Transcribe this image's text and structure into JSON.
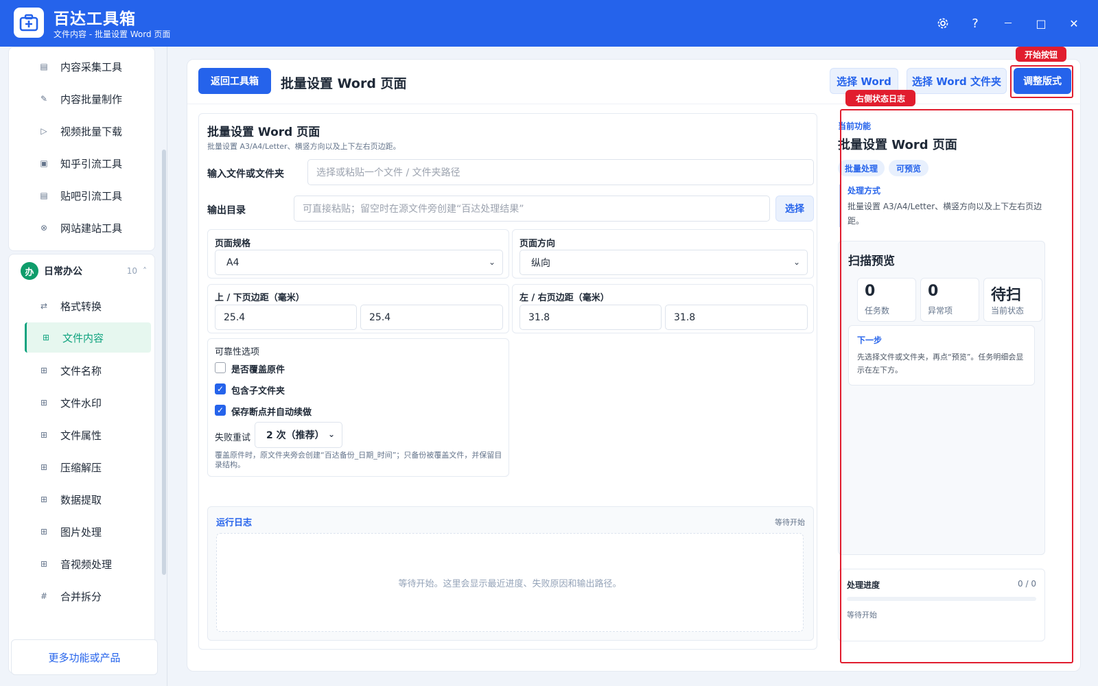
{
  "app": {
    "title": "百达工具箱",
    "subtitle": "文件内容 - 批量设置 Word 页面"
  },
  "window_controls": {
    "settings_icon": "gear-icon",
    "help": "?",
    "minimize": "－",
    "maximize": "□",
    "close": "✕"
  },
  "sidebar": {
    "top_items": [
      {
        "label": "内容采集工具",
        "icon": "collect-icon"
      },
      {
        "label": "内容批量制作",
        "icon": "pen-icon"
      },
      {
        "label": "视频批量下载",
        "icon": "video-icon"
      },
      {
        "label": "知乎引流工具",
        "icon": "zhihu-icon"
      },
      {
        "label": "贴吧引流工具",
        "icon": "tieba-icon"
      },
      {
        "label": "网站建站工具",
        "icon": "web-icon"
      }
    ],
    "group": {
      "badge": "办",
      "title": "日常办公",
      "count": "10",
      "chevron": "˄"
    },
    "group_items": [
      {
        "label": "格式转换",
        "icon": "swap-icon"
      },
      {
        "label": "文件内容",
        "icon": "grid-icon"
      },
      {
        "label": "文件名称",
        "icon": "grid-icon"
      },
      {
        "label": "文件水印",
        "icon": "grid-icon"
      },
      {
        "label": "文件属性",
        "icon": "grid-icon"
      },
      {
        "label": "压缩解压",
        "icon": "grid-icon"
      },
      {
        "label": "数据提取",
        "icon": "grid-icon"
      },
      {
        "label": "图片处理",
        "icon": "grid-icon"
      },
      {
        "label": "音视频处理",
        "icon": "grid-icon"
      },
      {
        "label": "合并拆分",
        "icon": "hash-icon"
      }
    ],
    "active_item": "文件内容",
    "more_button": "更多功能或产品"
  },
  "header": {
    "back_button": "返回工具箱",
    "page_title": "批量设置 Word 页面",
    "select_word": "选择 Word",
    "select_word_folder": "选择 Word 文件夹",
    "run_button": "调整版式"
  },
  "annotations": {
    "start_button_tag": "开始按钮",
    "right_log_tag": "右侧状态日志"
  },
  "form": {
    "title": "批量设置 Word 页面",
    "description": "批量设置 A3/A4/Letter、横竖方向以及上下左右页边距。",
    "input_label": "输入文件或文件夹",
    "input_placeholder": "选择或粘贴一个文件 / 文件夹路径",
    "output_label": "输出目录",
    "output_placeholder": "可直接粘贴；留空时在源文件旁创建“百达处理结果”",
    "output_select": "选择",
    "page_size_label": "页面规格",
    "page_size_value": "A4",
    "orientation_label": "页面方向",
    "orientation_value": "纵向",
    "tb_margin_label": "上 / 下页边距（毫米）",
    "top_margin": "25.4",
    "bottom_margin": "25.4",
    "lr_margin_label": "左 / 右页边距（毫米）",
    "left_margin": "31.8",
    "right_margin": "31.8",
    "reliability_label": "可靠性选项",
    "overwrite_label": "是否覆盖原件",
    "overwrite_checked": false,
    "subfolders_label": "包含子文件夹",
    "subfolders_checked": true,
    "resume_label": "保存断点并自动续做",
    "resume_checked": true,
    "retry_label": "失败重试",
    "retry_value": "2 次（推荐）",
    "note": "覆盖原件时，原文件夹旁会创建“百达备份_日期_时间”；只备份被覆盖文件，并保留目录结构。"
  },
  "log": {
    "title": "运行日志",
    "status": "等待开始",
    "empty_text": "等待开始。这里会显示最近进度、失败原因和输出路径。"
  },
  "right_panel": {
    "current_label": "当前功能",
    "title": "批量设置 Word 页面",
    "chips": [
      "批量处理",
      "可预览"
    ],
    "method_title": "处理方式",
    "method_text": "批量设置 A3/A4/Letter、横竖方向以及上下左右页边距。",
    "scan_title": "扫描预览",
    "stats": [
      {
        "value": "0",
        "label": "任务数"
      },
      {
        "value": "0",
        "label": "异常项"
      },
      {
        "value": "待扫",
        "label": "当前状态"
      }
    ],
    "next_title": "下一步",
    "next_text": "先选择文件或文件夹，再点“预览”。任务明细会显示在左下方。",
    "progress_title": "处理进度",
    "progress_count": "0 / 0",
    "progress_fraction": 0,
    "progress_status": "等待开始"
  }
}
